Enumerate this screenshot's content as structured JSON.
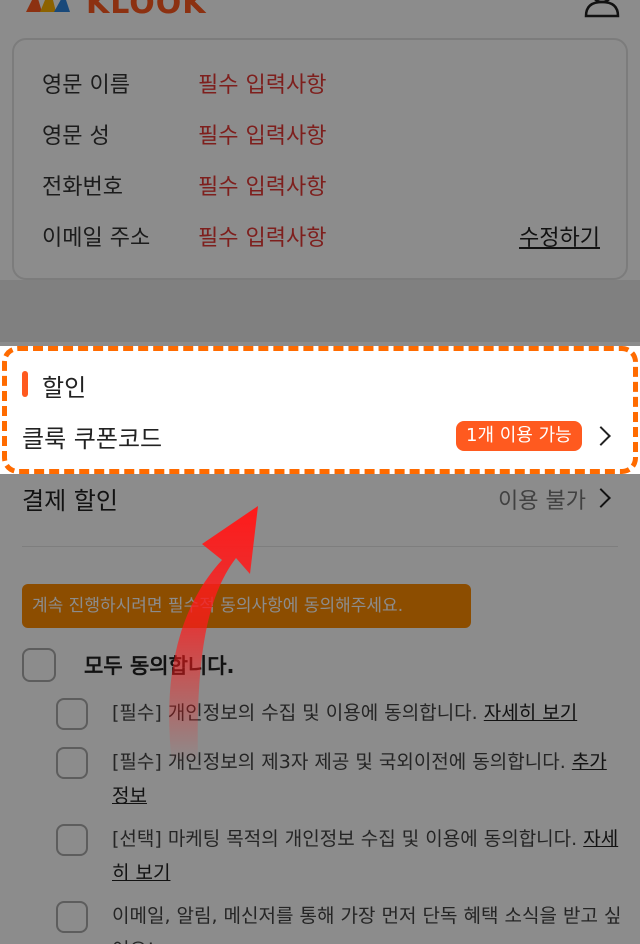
{
  "header": {
    "logo_text": "KLOOK",
    "logo_icon": "klook-logo-icon",
    "user_icon": "user-icon"
  },
  "traveler_info": {
    "rows": [
      {
        "label": "영문 이름",
        "value": "필수 입력사항"
      },
      {
        "label": "영문 성",
        "value": "필수 입력사항"
      },
      {
        "label": "전화번호",
        "value": "필수 입력사항"
      },
      {
        "label": "이메일 주소",
        "value": "필수 입력사항"
      }
    ],
    "edit_label": "수정하기"
  },
  "discount": {
    "title": "할인",
    "coupon_label": "클룩 쿠폰코드",
    "coupon_badge": "1개 이용 가능",
    "payment_label": "결제 할인",
    "payment_status": "이용 불가"
  },
  "agreement": {
    "warning": "계속 진행하시려면 필수적 동의사항에 동의해주세요.",
    "agree_all": "모두 동의합니다.",
    "terms": [
      {
        "text": "[필수] 개인정보의 수집 및 이용에 동의합니다.",
        "link": "자세히 보기"
      },
      {
        "text": "[필수] 개인정보의 제3자 제공 및 국외이전에 동의합니다.",
        "link": "추가 정보"
      },
      {
        "text": "[선택] 마케팅 목적의 개인정보 수집 및 이용에 동의합니다.",
        "link": "자세히 보기"
      },
      {
        "text": "이메일, 알림, 메신저를 통해 가장 먼저 단독 혜택 소식을 받고 싶어요!",
        "link": ""
      }
    ]
  },
  "colors": {
    "accent": "#ff5a1f",
    "required": "#e53935",
    "warning": "#ff8c00",
    "highlight": "#ff6b00",
    "arrow": "#ff1a1a"
  }
}
